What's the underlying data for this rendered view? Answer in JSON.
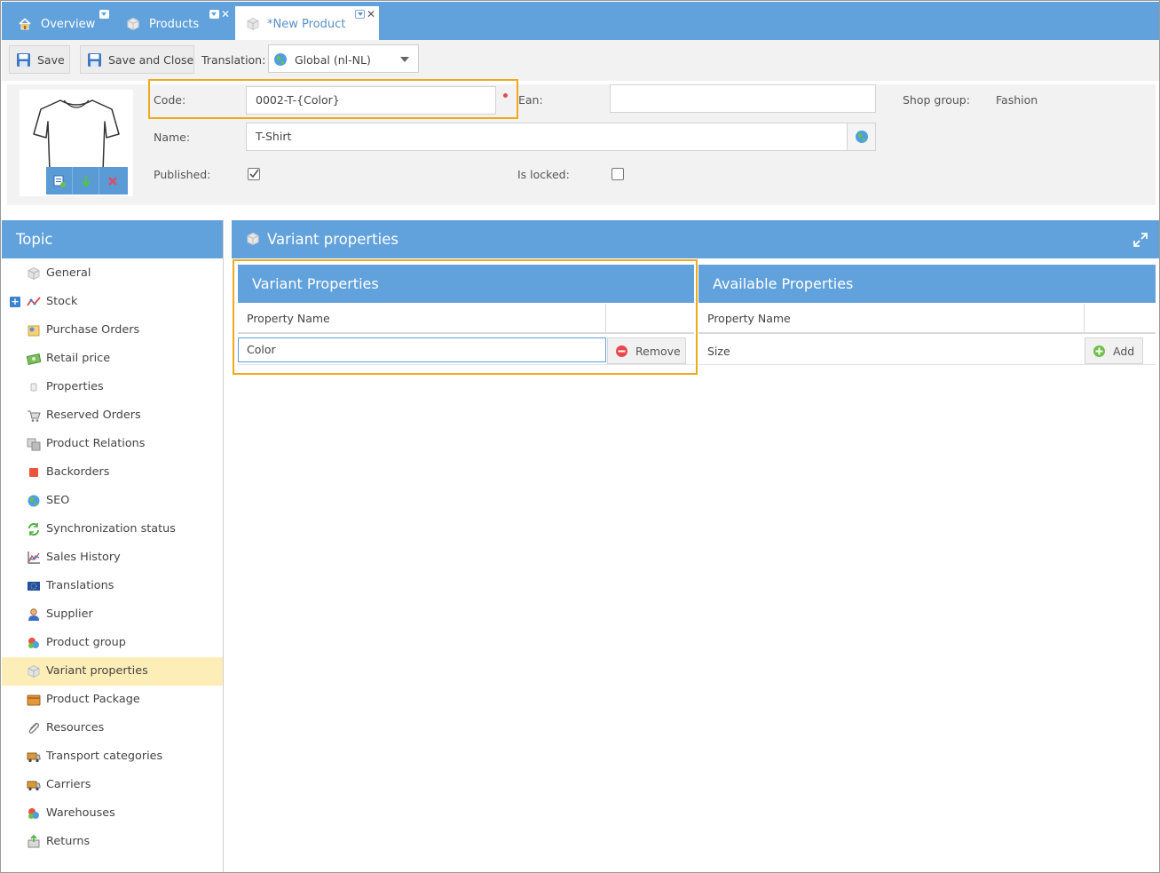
{
  "tabs": [
    {
      "label": "Overview",
      "icon": "home-icon"
    },
    {
      "label": "Products",
      "icon": "cube-icon"
    },
    {
      "label": "*New Product",
      "icon": "cube-icon",
      "active": true
    }
  ],
  "toolbar": {
    "save_label": "Save",
    "save_close_label": "Save and Close",
    "translation_label": "Translation:",
    "translation_value": "Global (nl-NL)"
  },
  "form": {
    "code_label": "Code:",
    "code_value": "0002-T-{Color}",
    "ean_label": "Ean:",
    "ean_value": "",
    "shop_group_label": "Shop group:",
    "shop_group_value": "Fashion",
    "name_label": "Name:",
    "name_value": "T-Shirt",
    "published_label": "Published:",
    "published_checked": true,
    "is_locked_label": "Is locked:",
    "is_locked_checked": false
  },
  "sidebar": {
    "title": "Topic",
    "items": [
      {
        "label": "General",
        "icon": "cube-icon"
      },
      {
        "label": "Stock",
        "icon": "chart-line-icon",
        "expandable": true
      },
      {
        "label": "Purchase Orders",
        "icon": "purchase-orders-icon"
      },
      {
        "label": "Retail price",
        "icon": "money-icon"
      },
      {
        "label": "Properties",
        "icon": "properties-icon"
      },
      {
        "label": "Reserved Orders",
        "icon": "cart-icon"
      },
      {
        "label": "Product Relations",
        "icon": "relations-icon"
      },
      {
        "label": "Backorders",
        "icon": "backorders-icon"
      },
      {
        "label": "SEO",
        "icon": "globe-icon"
      },
      {
        "label": "Synchronization status",
        "icon": "sync-icon"
      },
      {
        "label": "Sales History",
        "icon": "sales-chart-icon"
      },
      {
        "label": "Translations",
        "icon": "flag-icon"
      },
      {
        "label": "Supplier",
        "icon": "person-icon"
      },
      {
        "label": "Product group",
        "icon": "group-icon"
      },
      {
        "label": "Variant properties",
        "icon": "cube-icon",
        "selected": true
      },
      {
        "label": "Product Package",
        "icon": "package-icon"
      },
      {
        "label": "Resources",
        "icon": "paperclip-icon"
      },
      {
        "label": "Transport categories",
        "icon": "truck-icon"
      },
      {
        "label": "Carriers",
        "icon": "truck-icon"
      },
      {
        "label": "Warehouses",
        "icon": "group-icon"
      },
      {
        "label": "Returns",
        "icon": "returns-icon"
      }
    ]
  },
  "main": {
    "title": "Variant properties",
    "variant_grid": {
      "title": "Variant Properties",
      "column": "Property Name",
      "rows": [
        {
          "value": "Color",
          "action": "Remove"
        }
      ]
    },
    "available_grid": {
      "title": "Available Properties",
      "column": "Property Name",
      "rows": [
        {
          "value": "Size",
          "action": "Add"
        }
      ]
    }
  },
  "colors": {
    "header_blue": "#62a2dc",
    "highlight_orange": "#f0a91c",
    "selected_row": "#fdeeb8"
  }
}
